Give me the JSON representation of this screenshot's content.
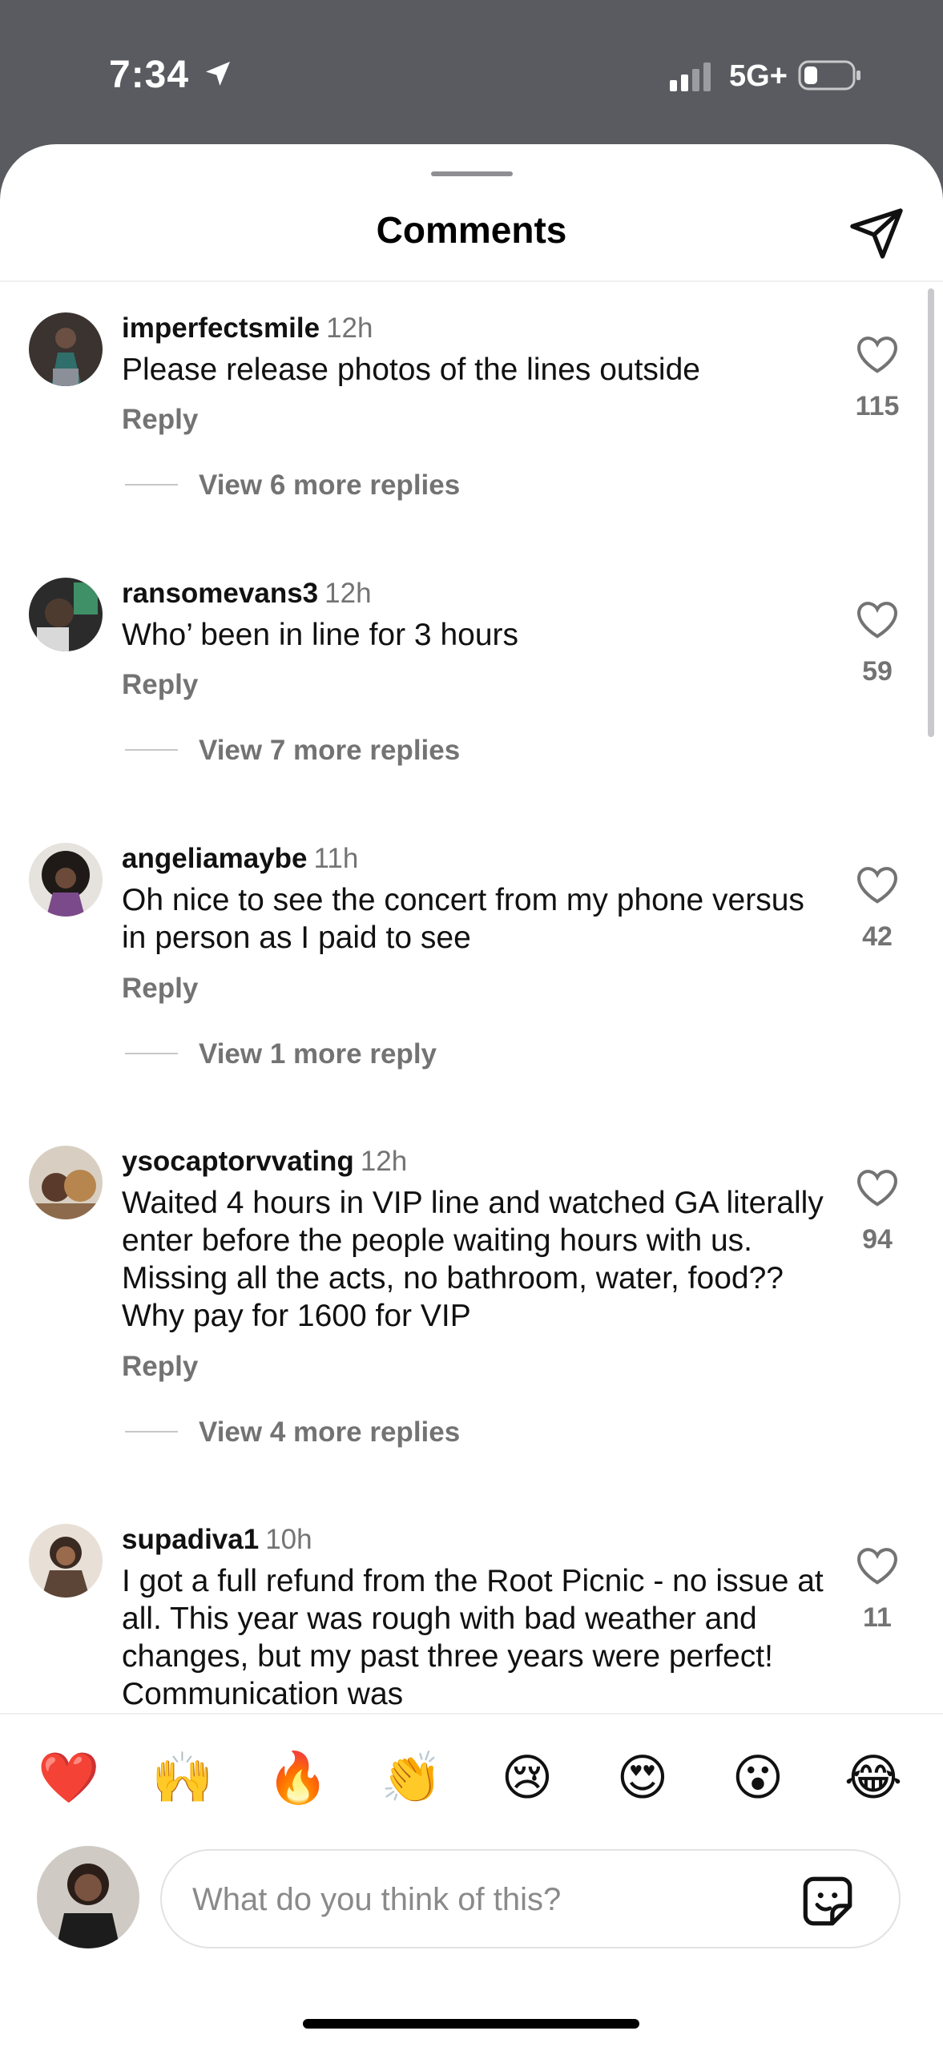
{
  "status": {
    "time": "7:34",
    "network": "5G+"
  },
  "sheet": {
    "title": "Comments"
  },
  "comments": [
    {
      "username": "imperfectsmile",
      "age": "12h",
      "text": "Please release photos of the lines outside",
      "reply_label": "Reply",
      "likes": "115",
      "view_more": "View 6 more replies"
    },
    {
      "username": "ransomevans3",
      "age": "12h",
      "text": "Who’ been in line for 3 hours",
      "reply_label": "Reply",
      "likes": "59",
      "view_more": "View 7 more replies"
    },
    {
      "username": "angeliamaybe",
      "age": "11h",
      "text": "Oh nice to see the concert from my phone versus in person as I paid to see",
      "reply_label": "Reply",
      "likes": "42",
      "view_more": "View 1 more reply"
    },
    {
      "username": "ysocaptorvvating",
      "age": "12h",
      "text": "Waited 4 hours in VIP line and watched GA literally enter before the people waiting hours with us. Missing all the acts, no bathroom, water, food?? Why pay for 1600 for VIP",
      "reply_label": "Reply",
      "likes": "94",
      "view_more": "View 4 more replies"
    },
    {
      "username": "supadiva1",
      "age": "10h",
      "text": "I got a full refund from the Root Picnic - no issue at all. This year was rough with bad weather and changes, but my past three years were perfect!  Communication was",
      "likes": "11"
    }
  ],
  "quick_reactions": [
    "❤️",
    "🙌",
    "🔥",
    "👏",
    "😢",
    "😍",
    "😮",
    "😂"
  ],
  "composer": {
    "placeholder": "What do you think of this?"
  }
}
